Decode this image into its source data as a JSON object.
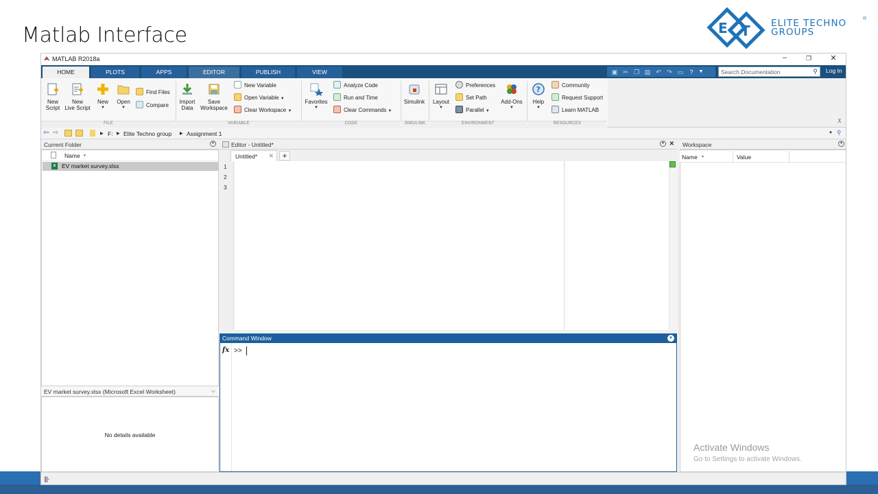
{
  "slide": {
    "title": "Matlab Interface"
  },
  "brand": {
    "line1": "ELITE TECHNO",
    "line2": "GROUPS",
    "reg": "®",
    "colors": {
      "primary": "#1e73b8"
    }
  },
  "window": {
    "title": "MATLAB R2018a",
    "controls": [
      "minimize",
      "restore",
      "close"
    ]
  },
  "tabs": [
    "HOME",
    "PLOTS",
    "APPS",
    "EDITOR",
    "PUBLISH",
    "VIEW"
  ],
  "active_tab": "HOME",
  "quick_access": {
    "search_placeholder": "Search Documentation",
    "login": "Log In"
  },
  "ribbon": {
    "file": {
      "label": "FILE",
      "new_script": [
        "New",
        "Script"
      ],
      "new_live_script": [
        "New",
        "Live Script"
      ],
      "new": "New",
      "open": "Open",
      "find_files": "Find Files",
      "compare": "Compare"
    },
    "variable": {
      "label": "VARIABLE",
      "import_data": [
        "Import",
        "Data"
      ],
      "save_workspace": [
        "Save",
        "Workspace"
      ],
      "new_variable": "New Variable",
      "open_variable": "Open Variable",
      "clear_workspace": "Clear Workspace"
    },
    "code": {
      "label": "CODE",
      "favorites": "Favorites",
      "analyze_code": "Analyze Code",
      "run_and_time": "Run and Time",
      "clear_commands": "Clear Commands"
    },
    "simulink": {
      "label": "SIMULINK",
      "simulink": "Simulink"
    },
    "environment": {
      "label": "ENVIRONMENT",
      "layout": "Layout",
      "preferences": "Preferences",
      "set_path": "Set Path",
      "parallel": "Parallel",
      "add_ons": "Add-Ons"
    },
    "resources": {
      "label": "RESOURCES",
      "help": "Help",
      "community": "Community",
      "request_support": "Request Support",
      "learn_matlab": "Learn MATLAB"
    }
  },
  "address": {
    "drive": "F:",
    "folder1": "Elite Techno group",
    "folder2": "Assignment 1"
  },
  "current_folder": {
    "title": "Current Folder",
    "column": "Name",
    "files": [
      {
        "name": "EV market survey.xlsx",
        "icon": "excel-file-icon"
      }
    ],
    "details_title": "EV market survey.xlsx  (Microsoft Excel Worksheet)",
    "details_text": "No details available"
  },
  "editor": {
    "title": "Editor - Untitled*",
    "tab": "Untitled*",
    "line_numbers": [
      "1",
      "2",
      "3"
    ]
  },
  "command_window": {
    "title": "Command Window",
    "fx": "fx",
    "prompt": ">>"
  },
  "workspace": {
    "title": "Workspace",
    "columns": [
      "Name",
      "Value"
    ]
  },
  "watermark": {
    "line1": "Activate Windows",
    "line2": "Go to Settings to activate Windows."
  },
  "colors": {
    "tabbar": "#1b4f7d",
    "command_header": "#1b5f9e",
    "bottom_band": "#2b6fb3"
  }
}
